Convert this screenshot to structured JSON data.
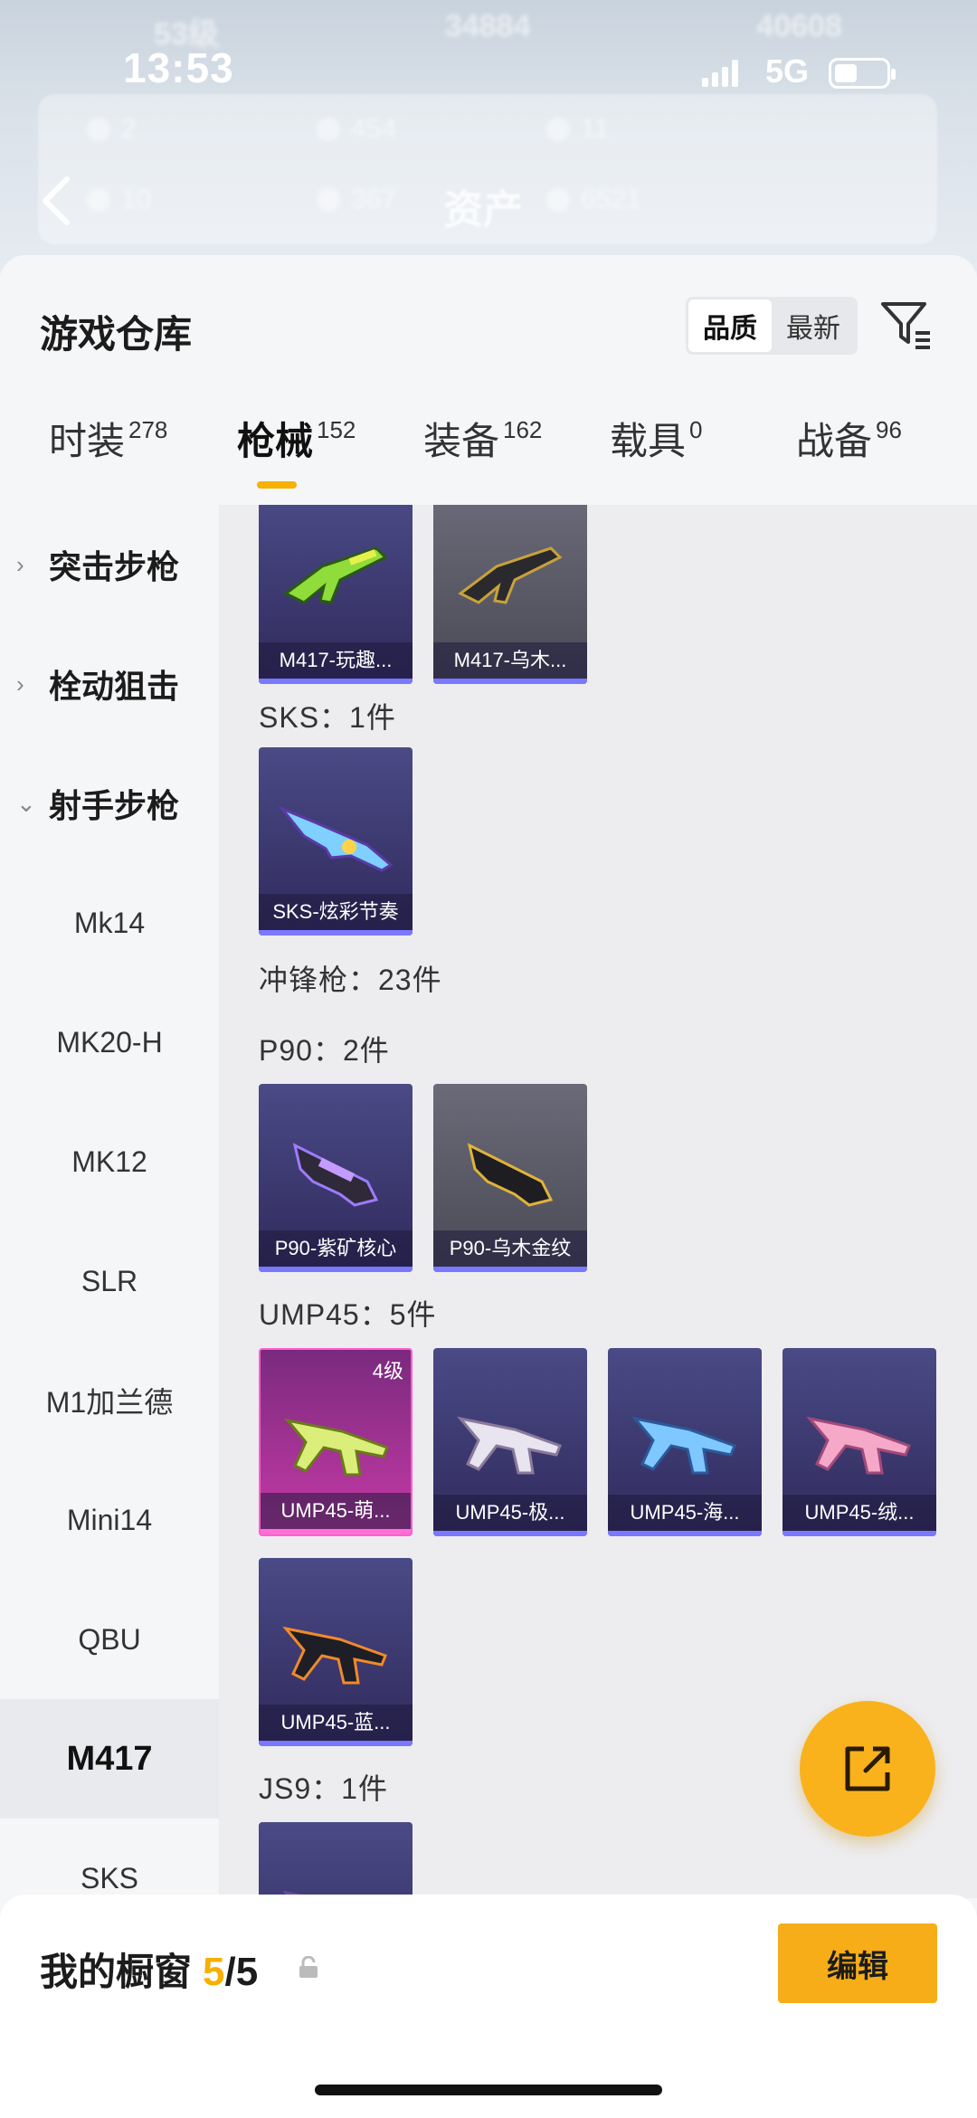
{
  "status_bar": {
    "time": "13:53",
    "network": "5G"
  },
  "backdrop": {
    "top_row": [
      "53级",
      "34884",
      "40608"
    ],
    "stats": [
      "2",
      "454",
      "11",
      "10",
      "367",
      "6521"
    ],
    "page_title": "资产"
  },
  "header": {
    "title": "游戏仓库",
    "sort_options": [
      "品质",
      "最新"
    ],
    "active_sort": "品质"
  },
  "tabs": [
    {
      "label": "时装",
      "count": "278"
    },
    {
      "label": "枪械",
      "count": "152"
    },
    {
      "label": "装备",
      "count": "162"
    },
    {
      "label": "载具",
      "count": "0"
    },
    {
      "label": "战备",
      "count": "96"
    }
  ],
  "sidebar": {
    "items": [
      {
        "label": "突击步枪",
        "type": "group",
        "expanded": false
      },
      {
        "label": "栓动狙击",
        "type": "group",
        "expanded": false
      },
      {
        "label": "射手步枪",
        "type": "group",
        "expanded": true
      },
      {
        "label": "Mk14",
        "type": "sub"
      },
      {
        "label": "MK20-H",
        "type": "sub"
      },
      {
        "label": "MK12",
        "type": "sub"
      },
      {
        "label": "SLR",
        "type": "sub"
      },
      {
        "label": "M1加兰德",
        "type": "sub"
      },
      {
        "label": "Mini14",
        "type": "sub"
      },
      {
        "label": "QBU",
        "type": "sub"
      },
      {
        "label": "M417",
        "type": "sub",
        "active": true
      },
      {
        "label": "SKS",
        "type": "sub"
      }
    ]
  },
  "content": {
    "m417_cards": [
      {
        "name": "M417-玩趣...",
        "style": "purple"
      },
      {
        "name": "M417-乌木...",
        "style": "grey"
      }
    ],
    "sks_label": "SKS：1件",
    "sks_cards": [
      {
        "name": "SKS-炫彩节奏",
        "style": "purple"
      }
    ],
    "smg_label": "冲锋枪：23件",
    "p90_label": "P90：2件",
    "p90_cards": [
      {
        "name": "P90-紫矿核心",
        "style": "purple"
      },
      {
        "name": "P90-乌木金纹",
        "style": "grey"
      }
    ],
    "ump_label": "UMP45：5件",
    "ump_cards": [
      {
        "name": "UMP45-萌...",
        "style": "pink",
        "level": "4级"
      },
      {
        "name": "UMP45-极...",
        "style": "purple"
      },
      {
        "name": "UMP45-海...",
        "style": "purple"
      },
      {
        "name": "UMP45-绒...",
        "style": "purple"
      },
      {
        "name": "UMP45-蓝...",
        "style": "purple"
      }
    ],
    "js9_label": "JS9：1件"
  },
  "footer": {
    "title": "我的橱窗",
    "used": "5",
    "separator": "/",
    "total": "5",
    "edit_label": "编辑"
  },
  "colors": {
    "accent": "#f7ad17",
    "card_purple": "#3c356e",
    "card_grey": "#5a5a66",
    "card_pink": "#c63aa6"
  }
}
